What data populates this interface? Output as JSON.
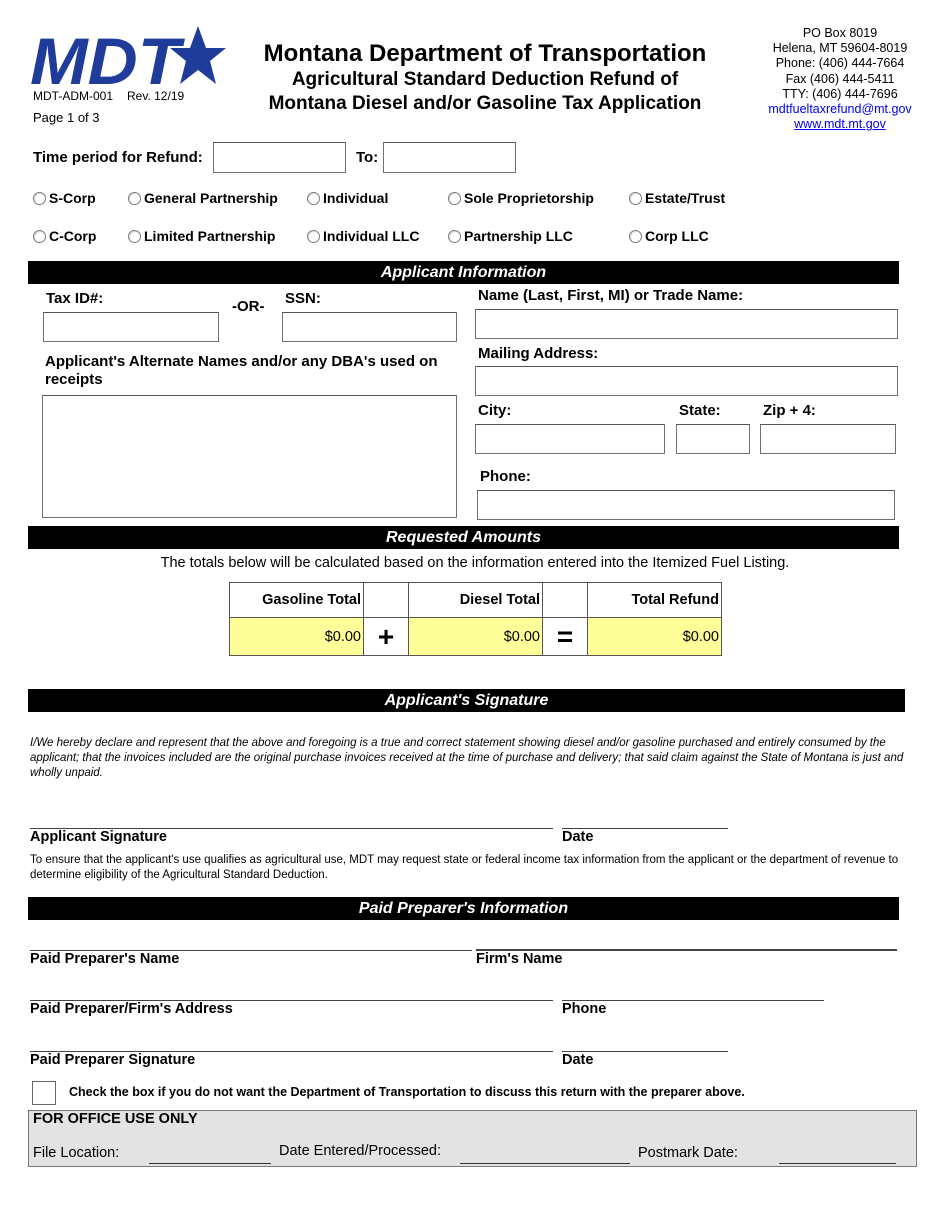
{
  "header": {
    "logo_text": "MDT",
    "brand_color": "#1f3c9b",
    "form_number": "MDT-ADM-001",
    "revision": "Rev. 12/19",
    "page": "Page 1 of 3",
    "title": "Montana Department of Transportation",
    "subtitle_line1": "Agricultural Standard Deduction Refund of",
    "subtitle_line2": "Montana Diesel and/or Gasoline Tax Application",
    "contact": {
      "po_box": "PO Box 8019",
      "city_line": "Helena, MT 59604-8019",
      "phone": "Phone: (406) 444-7664",
      "fax": "Fax (406) 444-5411",
      "tty": "TTY: (406) 444-7696",
      "email": "mdtfueltaxrefund@mt.gov",
      "website": "www.mdt.mt.gov"
    }
  },
  "time_period": {
    "label": "Time period for Refund:",
    "from_value": "",
    "to_label": "To:",
    "to_value": ""
  },
  "entity_types": [
    {
      "label": "S-Corp",
      "selected": false
    },
    {
      "label": "General Partnership",
      "selected": false
    },
    {
      "label": "Individual",
      "selected": false
    },
    {
      "label": "Sole Proprietorship",
      "selected": false
    },
    {
      "label": "Estate/Trust",
      "selected": false
    },
    {
      "label": "C-Corp",
      "selected": false
    },
    {
      "label": "Limited Partnership",
      "selected": false
    },
    {
      "label": "Individual LLC",
      "selected": false
    },
    {
      "label": "Partnership LLC",
      "selected": false
    },
    {
      "label": "Corp LLC",
      "selected": false
    }
  ],
  "applicant": {
    "section_title": "Applicant Information",
    "tax_id_label": "Tax ID#:",
    "tax_id_value": "",
    "or_label": "-OR-",
    "ssn_label": "SSN:",
    "ssn_value": "",
    "alt_names_label": "Applicant's Alternate Names and/or any DBA's used on receipts",
    "alt_names_value": "",
    "name_label": "Name (Last, First, MI) or Trade Name:",
    "name_value": "",
    "mailing_label": "Mailing Address:",
    "mailing_value": "",
    "city_label": "City:",
    "city_value": "",
    "state_label": "State:",
    "state_value": "",
    "zip_label": "Zip + 4:",
    "zip_value": "",
    "phone_label": "Phone:",
    "phone_value": ""
  },
  "amounts": {
    "section_title": "Requested Amounts",
    "note": "The totals below will be calculated based on the information entered into the Itemized Fuel Listing.",
    "gasoline_label": "Gasoline Total",
    "gasoline_value": "$0.00",
    "plus_symbol": "+",
    "diesel_label": "Diesel Total",
    "diesel_value": "$0.00",
    "equals_symbol": "=",
    "total_label": "Total Refund",
    "total_value": "$0.00",
    "highlight_color": "#ffff99"
  },
  "signature": {
    "section_title": "Applicant's Signature",
    "declaration": "I/We hereby declare and represent that the above and foregoing is a true and correct statement showing diesel and/or gasoline purchased and entirely consumed by the applicant; that the invoices included are the original purchase invoices received at the time of purchase and delivery; that said claim against the State of Montana is just and wholly unpaid.",
    "applicant_signature_label": "Applicant Signature",
    "date_label": "Date",
    "note": "To ensure that the applicant's use qualifies as agricultural use, MDT may request state or federal income tax information from the applicant or the department of revenue to determine eligibility of the Agricultural Standard Deduction."
  },
  "preparer": {
    "section_title": "Paid Preparer's Information",
    "name_label": "Paid Preparer's Name",
    "firm_label": "Firm's Name",
    "address_label": "Paid Preparer/Firm's Address",
    "phone_label": "Phone",
    "signature_label": "Paid Preparer Signature",
    "date_label": "Date",
    "opt_out_label": "Check the box if you do not want the Department of Transportation to discuss this return with the preparer above.",
    "opt_out_checked": false
  },
  "office_use": {
    "title": "FOR OFFICE USE ONLY",
    "file_location_label": "File Location:",
    "date_entered_label": "Date Entered/Processed:",
    "postmark_label": "Postmark Date:"
  }
}
